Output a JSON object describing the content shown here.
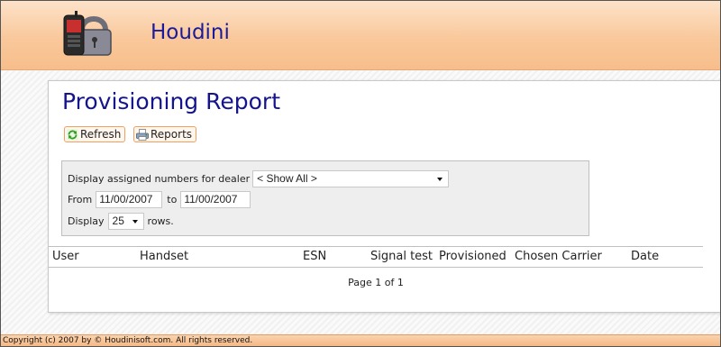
{
  "app": {
    "title": "Houdini"
  },
  "page": {
    "title": "Provisioning Report"
  },
  "toolbar": {
    "refresh_label": "Refresh",
    "reports_label": "Reports"
  },
  "filters": {
    "dealer_label": "Display assigned numbers for dealer",
    "dealer_value": "< Show All >",
    "from_label": "From",
    "from_value": "11/00/2007",
    "to_label": "to",
    "to_value": "11/00/2007",
    "display_label": "Display",
    "rows_value": "25",
    "rows_suffix": "rows."
  },
  "table": {
    "columns": [
      "User",
      "Handset",
      "ESN",
      "Signal test",
      "Provisioned",
      "Chosen Carrier",
      "Date"
    ]
  },
  "pager": {
    "text": "Page 1 of 1"
  },
  "footer": {
    "text": "Copyright (c) 2007 by © Houdinisoft.com. All rights reserved."
  },
  "colors": {
    "header_orange": "#f9c89b",
    "title_blue": "#14148c",
    "button_border": "#f0a060"
  },
  "icons": {
    "refresh": "refresh-icon",
    "reports": "printer-icon",
    "logo": "phone-padlock-logo"
  }
}
